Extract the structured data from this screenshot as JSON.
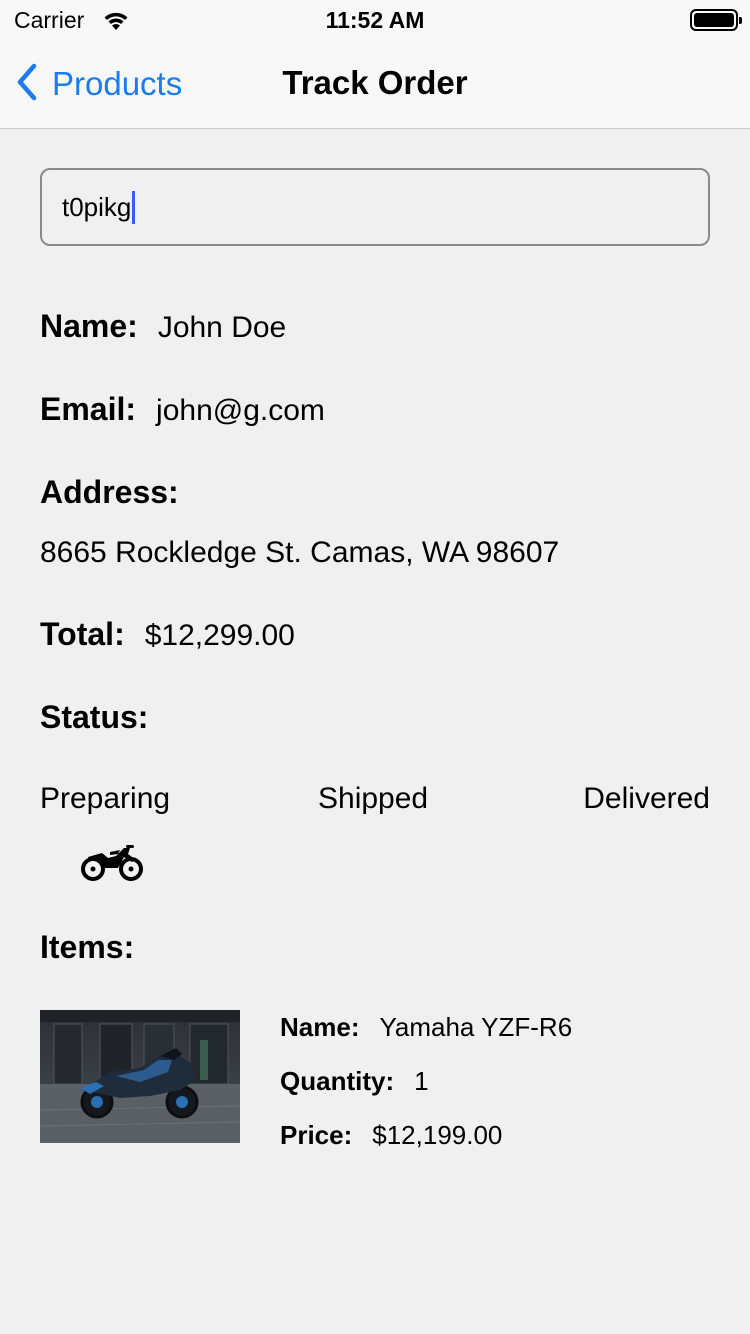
{
  "status_bar": {
    "carrier": "Carrier",
    "time": "11:52 AM"
  },
  "nav": {
    "back_label": "Products",
    "title": "Track Order"
  },
  "search": {
    "value": "t0pikg"
  },
  "order": {
    "name_label": "Name:",
    "name": "John Doe",
    "email_label": "Email:",
    "email": "john@g.com",
    "address_label": "Address:",
    "address": "8665 Rockledge St. Camas, WA 98607",
    "total_label": "Total:",
    "total": "$12,299.00",
    "status_label": "Status:",
    "status_steps": [
      "Preparing",
      "Shipped",
      "Delivered"
    ],
    "current_step": "Preparing"
  },
  "items": {
    "heading": "Items:",
    "list": [
      {
        "name_label": "Name:",
        "name": "Yamaha YZF-R6",
        "quantity_label": "Quantity:",
        "quantity": "1",
        "price_label": "Price:",
        "price": "$12,199.00"
      }
    ]
  },
  "icons": {
    "back": "chevron-left-icon",
    "status_marker": "motorcycle-icon",
    "wifi": "wifi-icon",
    "battery": "battery-icon"
  },
  "colors": {
    "accent": "#1d7bf0",
    "caret": "#3d5afe"
  }
}
